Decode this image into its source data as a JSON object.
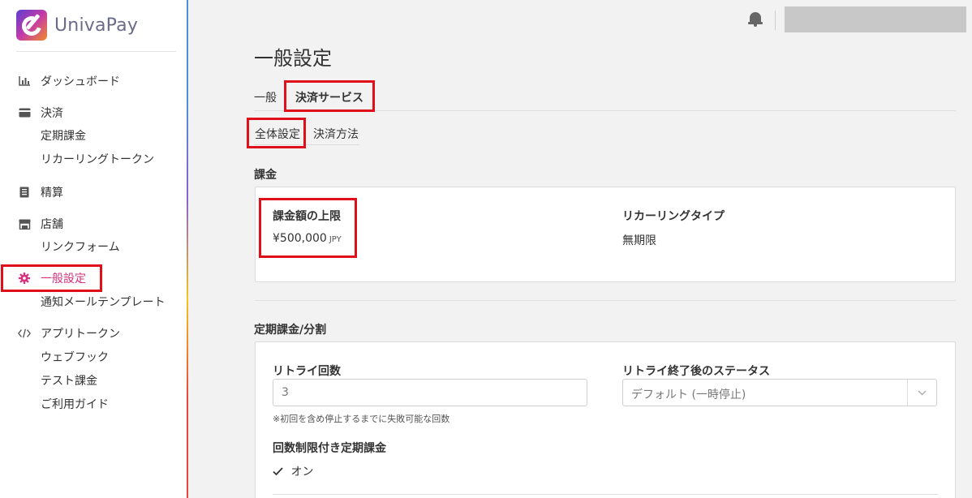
{
  "brand": {
    "name": "UnivaPay"
  },
  "sidebar": {
    "items": [
      {
        "icon": "bar-chart-icon",
        "label": "ダッシュボード"
      },
      {
        "icon": "credit-card-icon",
        "label": "決済",
        "children": [
          "定期課金",
          "リカーリングトークン"
        ]
      },
      {
        "icon": "document-icon",
        "label": "精算"
      },
      {
        "icon": "store-icon",
        "label": "店舗",
        "children": [
          "リンクフォーム"
        ]
      },
      {
        "icon": "gear-icon",
        "label": "一般設定",
        "active": true,
        "children": [
          "通知メールテンプレート"
        ]
      },
      {
        "icon": "code-icon",
        "label": "アプリトークン",
        "children": [
          "ウェブフック",
          "テスト課金",
          "ご利用ガイド"
        ]
      }
    ]
  },
  "page": {
    "title": "一般設定",
    "tabs": [
      {
        "label": "一般"
      },
      {
        "label": "決済サービス",
        "active": true
      }
    ],
    "subtabs": [
      {
        "label": "全体設定",
        "active": true
      },
      {
        "label": "決済方法"
      }
    ]
  },
  "billing": {
    "section_label": "課金",
    "limit_label": "課金額の上限",
    "limit_value": "¥500,000",
    "limit_unit": "JPY",
    "recurring_label": "リカーリングタイプ",
    "recurring_value": "無期限"
  },
  "subscription": {
    "section_label": "定期課金/分割",
    "retry_label": "リトライ回数",
    "retry_value": "3",
    "retry_hint": "※初回を含め停止するまでに失敗可能な回数",
    "status_label": "リトライ終了後のステータス",
    "status_value": "デフォルト (一時停止)",
    "limited_label": "回数制限付き定期課金",
    "limited_value": "オン"
  },
  "colors": {
    "accent": "#d6337c",
    "highlight": "#e0101b"
  }
}
